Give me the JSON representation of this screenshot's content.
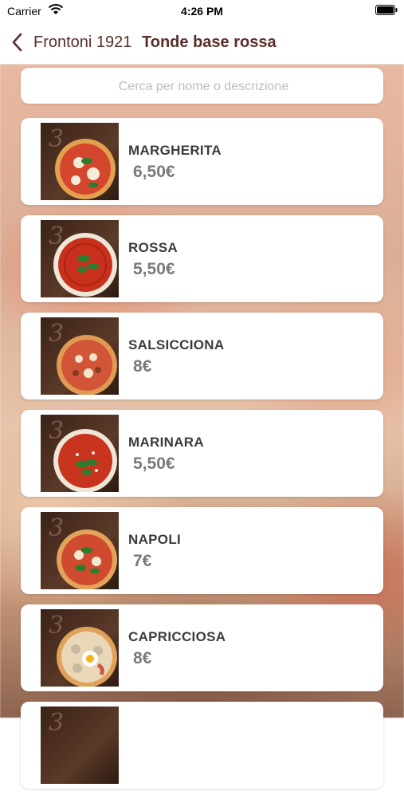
{
  "status_bar": {
    "carrier": "Carrier",
    "time": "4:26 PM"
  },
  "nav": {
    "back_label": "Frontoni 1921",
    "title": "Tonde base rossa"
  },
  "search": {
    "placeholder": "Cerca per nome o descrizione"
  },
  "colors": {
    "accent": "#5a2e2a",
    "price": "#7a7a7a",
    "name": "#3b3b3b"
  },
  "items": [
    {
      "name": "MARGHERITA",
      "price": "6,50€",
      "image_icon": "pizza-margherita-image"
    },
    {
      "name": "ROSSA",
      "price": "5,50€",
      "image_icon": "pizza-rossa-image"
    },
    {
      "name": "SALSICCIONA",
      "price": "8€",
      "image_icon": "pizza-salsicciona-image"
    },
    {
      "name": "MARINARA",
      "price": "5,50€",
      "image_icon": "pizza-marinara-image"
    },
    {
      "name": "NAPOLI",
      "price": "7€",
      "image_icon": "pizza-napoli-image"
    },
    {
      "name": "CAPRICCIOSA",
      "price": "8€",
      "image_icon": "pizza-capricciosa-image"
    },
    {
      "name": "",
      "price": "",
      "image_icon": "pizza-image"
    }
  ]
}
